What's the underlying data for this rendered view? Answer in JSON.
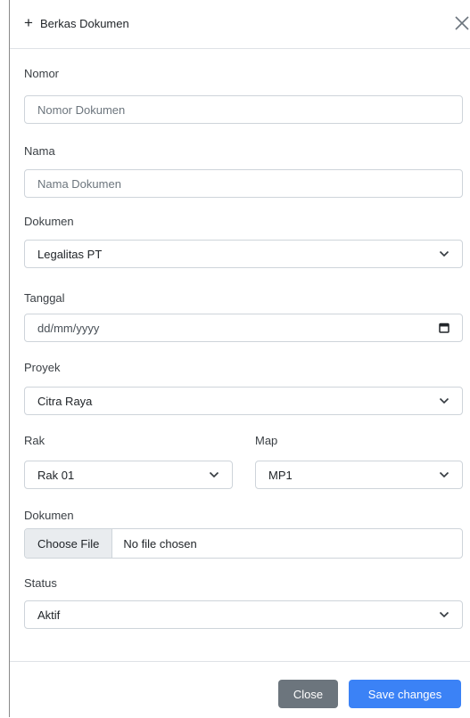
{
  "modal": {
    "title": "Berkas Dokumen",
    "plus_icon": "+",
    "close_icon": "close-icon"
  },
  "form": {
    "nomor": {
      "label": "Nomor",
      "placeholder": "Nomor Dokumen",
      "value": ""
    },
    "nama": {
      "label": "Nama",
      "placeholder": "Nama Dokumen",
      "value": ""
    },
    "dokumen_type": {
      "label": "Dokumen",
      "selected": "Legalitas PT"
    },
    "tanggal": {
      "label": "Tanggal",
      "placeholder": "dd/mm/yyyy"
    },
    "proyek": {
      "label": "Proyek",
      "selected": "Citra Raya"
    },
    "rak": {
      "label": "Rak",
      "selected": "Rak 01"
    },
    "map": {
      "label": "Map",
      "selected": "MP1"
    },
    "dokumen_file": {
      "label": "Dokumen",
      "button": "Choose File",
      "filename": "No file chosen"
    },
    "status": {
      "label": "Status",
      "selected": "Aktif"
    }
  },
  "footer": {
    "close_label": "Close",
    "save_label": "Save changes"
  },
  "colors": {
    "primary": "#3b82f6",
    "secondary": "#6c757d",
    "border": "#ced4da"
  }
}
